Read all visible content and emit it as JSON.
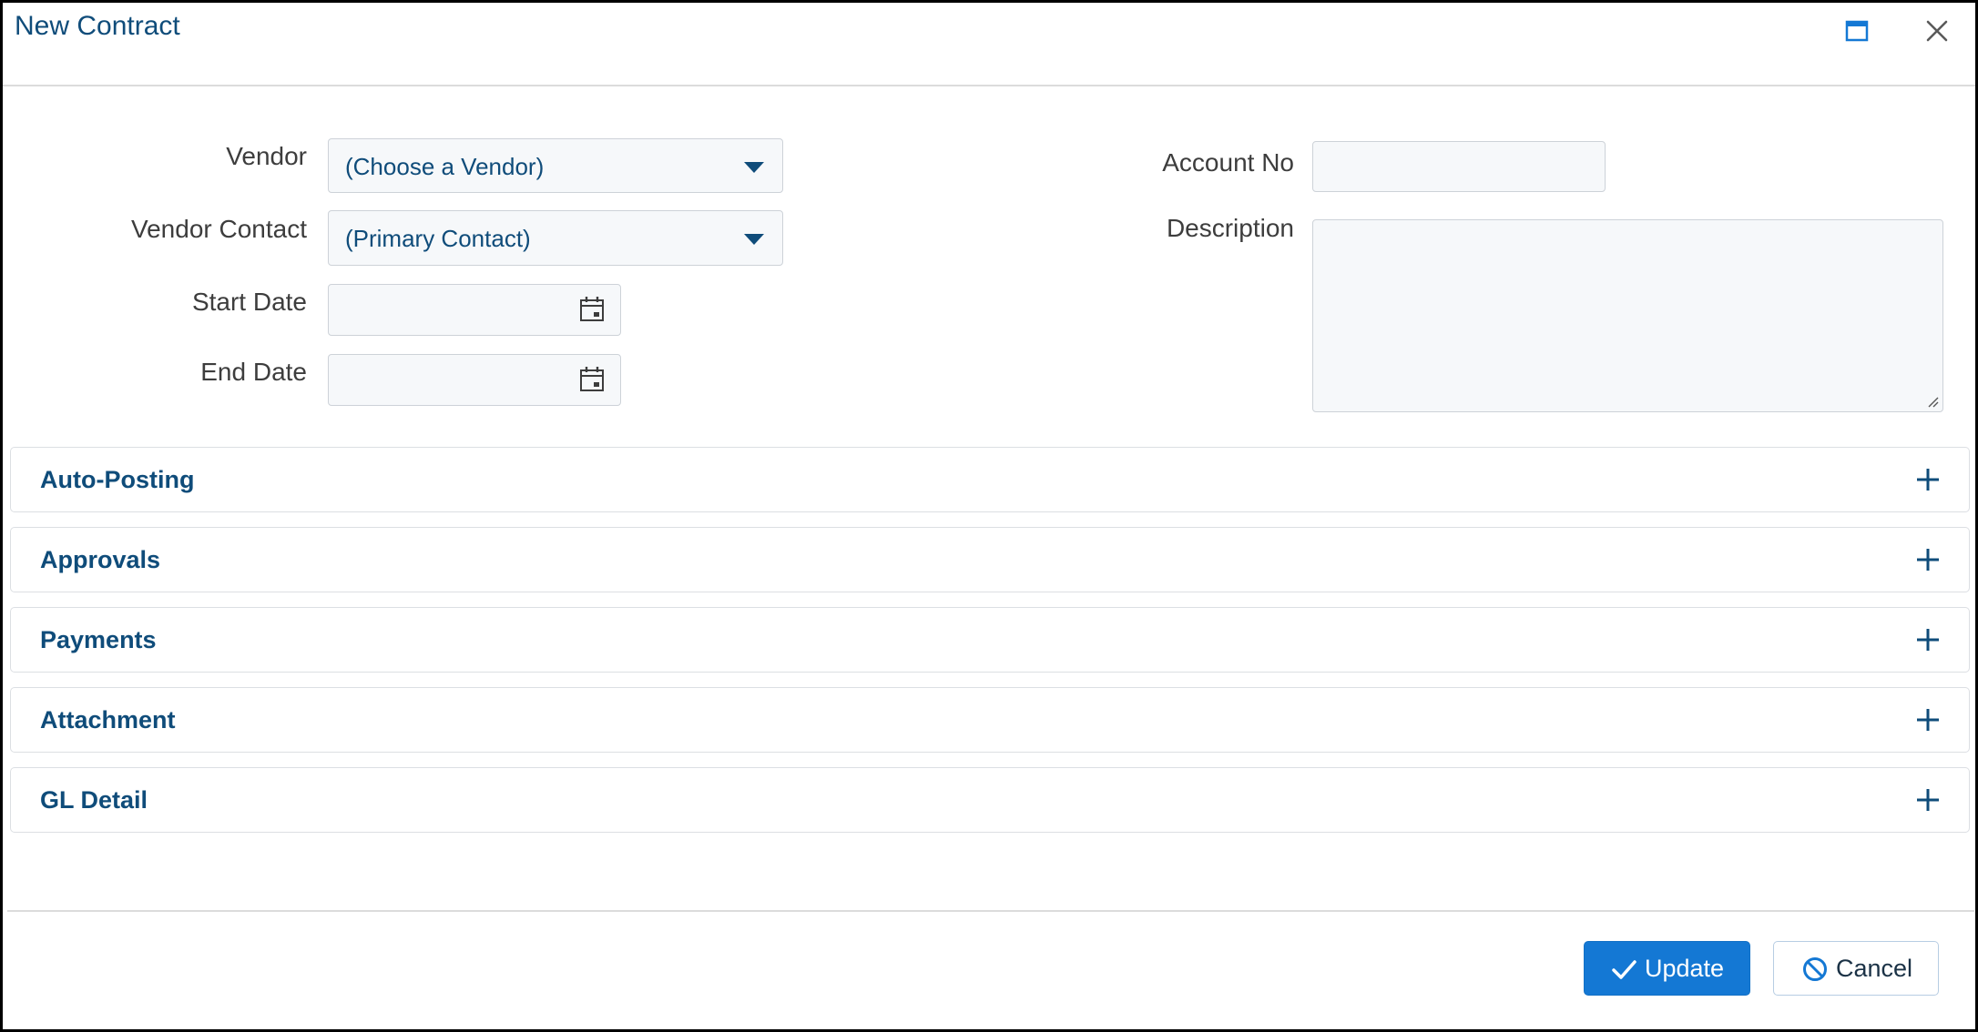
{
  "window": {
    "title": "New Contract"
  },
  "form": {
    "vendor": {
      "label": "Vendor",
      "value": "(Choose a Vendor)"
    },
    "vendor_contact": {
      "label": "Vendor Contact",
      "value": "(Primary Contact)"
    },
    "start_date": {
      "label": "Start Date",
      "value": ""
    },
    "end_date": {
      "label": "End Date",
      "value": ""
    },
    "account_no": {
      "label": "Account No",
      "value": ""
    },
    "description": {
      "label": "Description",
      "value": ""
    }
  },
  "sections": [
    {
      "label": "Auto-Posting"
    },
    {
      "label": "Approvals"
    },
    {
      "label": "Payments"
    },
    {
      "label": "Attachment"
    },
    {
      "label": "GL Detail"
    }
  ],
  "footer": {
    "update_label": "Update",
    "cancel_label": "Cancel"
  },
  "colors": {
    "accent": "#1478d4",
    "title_text": "#0f4c7a",
    "field_bg": "#f6f8fa"
  },
  "icons": {
    "maximize": "maximize-icon",
    "close": "close-icon",
    "dropdown": "caret-down-icon",
    "calendar": "calendar-icon",
    "expand": "plus-icon",
    "update": "check-icon",
    "cancel": "ban-icon"
  }
}
